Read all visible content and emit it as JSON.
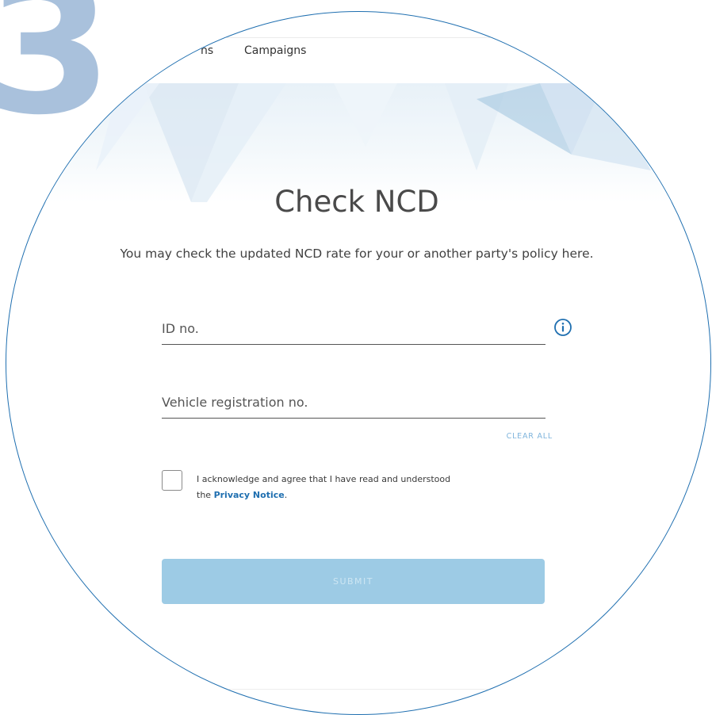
{
  "step": {
    "number": "3"
  },
  "nav": {
    "items": [
      "ns",
      "Campaigns"
    ]
  },
  "page": {
    "title": "Check NCD",
    "subtitle": "You may check the updated NCD rate for your or another party's policy here."
  },
  "form": {
    "id_field": {
      "placeholder": "ID no.",
      "value": ""
    },
    "vehicle_field": {
      "placeholder": "Vehicle registration no.",
      "value": ""
    },
    "info_icon": "info-circle-icon",
    "clear_all_label": "CLEAR ALL",
    "consent": {
      "checked": false,
      "text_line1": "I acknowledge and agree that I have read and understood",
      "text_prefix": "the ",
      "link_label": "Privacy Notice",
      "text_suffix": "."
    },
    "submit_label": "SUBMIT"
  },
  "colors": {
    "accent": "#1f6fb0",
    "step_number": "#a9c1dc",
    "submit_disabled": "#9dcbe5",
    "clear_all": "#7fb4dc"
  }
}
